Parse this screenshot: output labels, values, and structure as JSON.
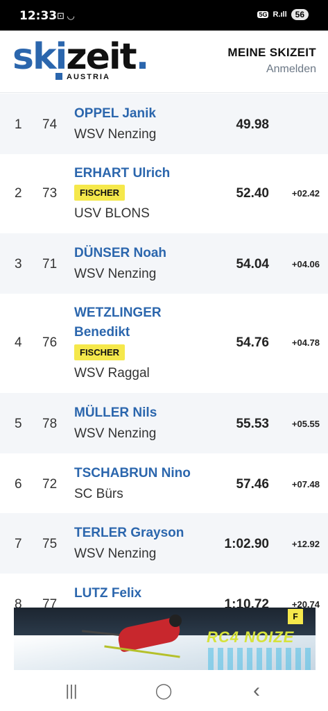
{
  "status": {
    "time": "12:33",
    "left_icons": "⊡ ◡",
    "network": "5G",
    "signal": "R.ıll",
    "battery": "56"
  },
  "header": {
    "logo_ski": "sk",
    "logo_i": "i",
    "logo_zeit": "zeit",
    "logo_dot": ".",
    "logo_sub": "AUSTRIA",
    "menu_title": "MEINE SKIZEIT",
    "login": "Anmelden"
  },
  "results": [
    {
      "rank": "1",
      "bib": "74",
      "name": "OPPEL Janik",
      "sponsor": "",
      "club": "WSV Nenzing",
      "time": "49.98",
      "diff": ""
    },
    {
      "rank": "2",
      "bib": "73",
      "name": "ERHART Ulrich",
      "sponsor": "FISCHER",
      "club": "USV BLONS",
      "time": "52.40",
      "diff": "+02.42"
    },
    {
      "rank": "3",
      "bib": "71",
      "name": "DÜNSER Noah",
      "sponsor": "",
      "club": "WSV Nenzing",
      "time": "54.04",
      "diff": "+04.06"
    },
    {
      "rank": "4",
      "bib": "76",
      "name": "WETZLINGER",
      "name2": "Benedikt",
      "sponsor": "FISCHER",
      "club": "WSV Raggal",
      "time": "54.76",
      "diff": "+04.78"
    },
    {
      "rank": "5",
      "bib": "78",
      "name": "MÜLLER Nils",
      "sponsor": "",
      "club": "WSV Nenzing",
      "time": "55.53",
      "diff": "+05.55"
    },
    {
      "rank": "6",
      "bib": "72",
      "name": "TSCHABRUN Nino",
      "sponsor": "",
      "club": "SC Bürs",
      "time": "57.46",
      "diff": "+07.48"
    },
    {
      "rank": "7",
      "bib": "75",
      "name": "TERLER Grayson",
      "sponsor": "",
      "club": "WSV Nenzing",
      "time": "1:02.90",
      "diff": "+12.92"
    },
    {
      "rank": "8",
      "bib": "77",
      "name": "LUTZ Felix",
      "sponsor": "",
      "club": "",
      "time": "1:10.72",
      "diff": "+20.74"
    }
  ],
  "ad": {
    "brand": "RC4 NOIZE",
    "logo": "F"
  },
  "navbar": {
    "recents": "|||",
    "home": "◯",
    "back": "‹"
  },
  "colors": {
    "accent": "#2b66ad",
    "badge": "#f5e84b",
    "row_alt": "#f4f6f9"
  }
}
